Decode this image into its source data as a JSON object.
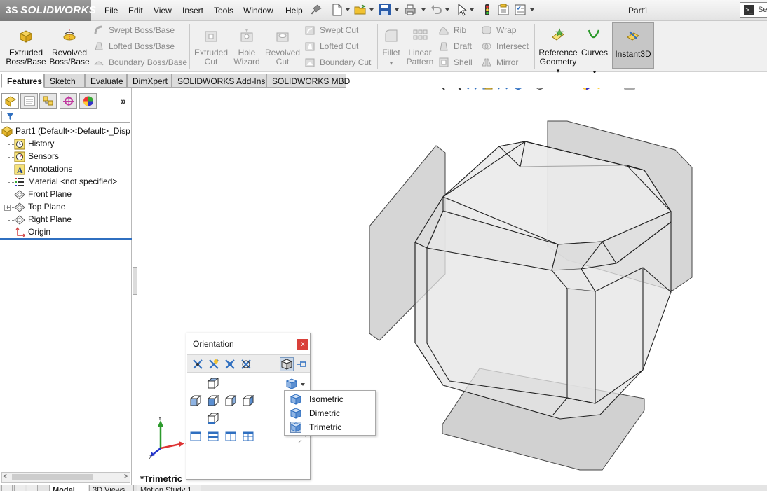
{
  "app": {
    "logo_text": "SOLIDWORKS",
    "document_title": "Part1",
    "search_placeholder": "Se"
  },
  "menu": {
    "items": [
      "File",
      "Edit",
      "View",
      "Insert",
      "Tools",
      "Window",
      "Help"
    ]
  },
  "commands": {
    "extruded_boss": "Extruded Boss/Base",
    "revolved_boss": "Revolved Boss/Base",
    "swept_boss": "Swept Boss/Base",
    "lofted_boss": "Lofted Boss/Base",
    "boundary_boss": "Boundary Boss/Base",
    "extruded_cut": "Extruded Cut",
    "hole_wizard": "Hole Wizard",
    "revolved_cut": "Revolved Cut",
    "swept_cut": "Swept Cut",
    "lofted_cut": "Lofted Cut",
    "boundary_cut": "Boundary Cut",
    "fillet": "Fillet",
    "linear_pattern": "Linear Pattern",
    "rib": "Rib",
    "draft": "Draft",
    "shell": "Shell",
    "wrap": "Wrap",
    "intersect": "Intersect",
    "mirror": "Mirror",
    "reference_geometry": "Reference Geometry",
    "curves": "Curves",
    "instant3d": "Instant3D"
  },
  "tabs": [
    "Features",
    "Sketch",
    "Evaluate",
    "DimXpert",
    "SOLIDWORKS Add-Ins",
    "SOLIDWORKS MBD"
  ],
  "tree": {
    "root": "Part1  (Default<<Default>_Disp",
    "items": [
      "History",
      "Sensors",
      "Annotations",
      "Material <not specified>",
      "Front Plane",
      "Top Plane",
      "Right Plane",
      "Origin"
    ]
  },
  "viewport": {
    "view_name": "*Trimetric",
    "triad_labels": [
      "Y",
      "X",
      "Z"
    ]
  },
  "orientation": {
    "title": "Orientation",
    "close": "x",
    "popup_items": [
      "Isometric",
      "Dimetric",
      "Trimetric"
    ],
    "selected": "Trimetric"
  },
  "bottom_tabs": [
    "Model",
    "3D Views",
    "Motion Study 1"
  ],
  "colors": {
    "accent": "#2f6fc0",
    "close_red": "#d9403a",
    "model_face": "#e4e4e4",
    "plane_face": "#cfcfcf"
  }
}
